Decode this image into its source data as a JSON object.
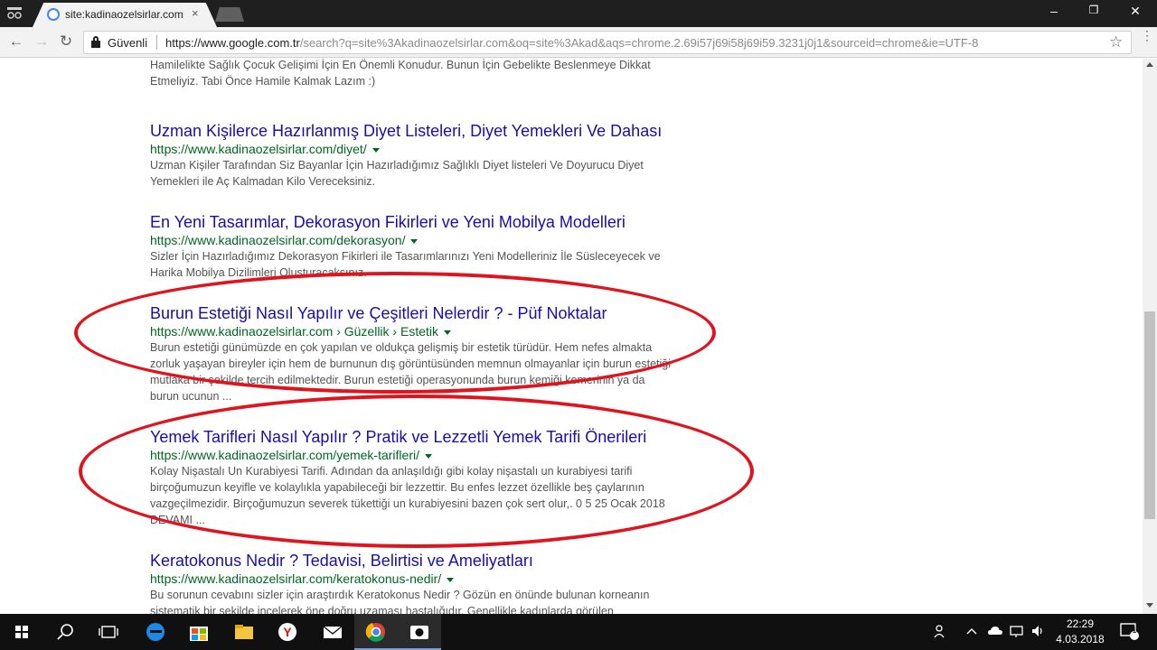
{
  "browser": {
    "tab_title": "site:kadinaozelsirlar.com",
    "tab_close": "×",
    "secure_label": "Güvenli",
    "url_host": "https://www.google.com.tr",
    "url_rest": "/search?q=site%3Akadinaozelsirlar.com&oq=site%3Akad&aqs=chrome.2.69i57j69i58j69i59.3231j0j1&sourceid=chrome&ie=UTF-8",
    "minimize": "–",
    "restore": "❐",
    "close": "✕",
    "back": "←",
    "forward": "→",
    "reload": "↻",
    "bookmark_star": "☆",
    "menu_dots": "⋮"
  },
  "results": [
    {
      "title": "",
      "url": "",
      "snippet_lines": [
        "Hamilelikte Sağlık Çocuk Gelişimi İçin En Önemli Konudur. Bunun İçin Gebelikte Beslenmeye Dikkat",
        "Etmeliyiz. Tabi Önce Hamile Kalmak Lazım :)"
      ]
    },
    {
      "title": "Uzman Kişilerce Hazırlanmış Diyet Listeleri, Diyet Yemekleri Ve Dahası",
      "url": "https://www.kadinaozelsirlar.com/diyet/",
      "snippet_lines": [
        "Uzman Kişiler Tarafından Siz Bayanlar İçin Hazırladığımız Sağlıklı Diyet listeleri Ve Doyurucu Diyet",
        "Yemekleri ile Aç Kalmadan Kilo Vereceksiniz."
      ]
    },
    {
      "title": "En Yeni Tasarımlar, Dekorasyon Fikirleri ve Yeni Mobilya Modelleri",
      "url": "https://www.kadinaozelsirlar.com/dekorasyon/",
      "snippet_lines": [
        "Sizler İçin Hazırladığımız Dekorasyon Fikirleri ile Tasarımlarınızı Yeni Modelleriniz İle Süsleceyecek ve",
        "Harika Mobilya Dizilimleri Oluşturacaksınız."
      ]
    },
    {
      "title": "Burun Estetiği Nasıl Yapılır ve Çeşitleri Nelerdir ? - Püf Noktalar",
      "url": "https://www.kadinaozelsirlar.com › Güzellik › Estetik",
      "snippet_lines": [
        "Burun estetiği günümüzde en çok yapılan ve oldukça gelişmiş bir estetik türüdür. Hem nefes almakta",
        "zorluk yaşayan bireyler için hem de burnunun dış görüntüsünden memnun olmayanlar için burun estetiği",
        "mutlaka bir şekilde tercih edilmektedir. Burun estetiği operasyonunda burun kemiği kemerinin ya da",
        "burun ucunun ..."
      ]
    },
    {
      "title": "Yemek Tarifleri Nasıl Yapılır ? Pratik ve Lezzetli Yemek Tarifi Önerileri",
      "url": "https://www.kadinaozelsirlar.com/yemek-tarifleri/",
      "snippet_lines": [
        "Kolay Nişastalı Un Kurabiyesi Tarifi. Adından da anlaşıldığı gibi kolay nişastalı un kurabiyesi tarifi",
        "birçoğumuzun keyifle ve kolaylıkla yapabileceği bir lezzettir. Bu enfes lezzet özellikle beş çaylarının",
        "vazgeçilmezidir. Birçoğumuzun severek tükettiği un kurabiyesini bazen çok sert olur,. 0 5 25 Ocak 2018",
        "DEVAMI ..."
      ]
    },
    {
      "title": "Keratokonus Nedir ? Tedavisi, Belirtisi ve Ameliyatları",
      "url": "https://www.kadinaozelsirlar.com/keratokonus-nedir/",
      "snippet_lines": [
        "Bu sorunun cevabını sizler için araştırdık Keratokonus Nedir ? Gözün en önünde bulunan korneanın",
        "sistematik bir şekilde incelerek öne doğru uzaması hastalığıdır. Genellikle kadınlarda görülen"
      ]
    }
  ],
  "annotations": {
    "color": "#e0141e",
    "highlighted_results": [
      3,
      4
    ]
  },
  "taskbar": {
    "time": "22:29",
    "date": "4.03.2018",
    "notification_count": "1",
    "icons": [
      "windows-start-icon",
      "search-icon",
      "task-view-icon",
      "edge-icon",
      "store-icon",
      "file-explorer-icon",
      "yandex-icon",
      "mail-icon",
      "chrome-icon",
      "camera-app-icon"
    ]
  }
}
